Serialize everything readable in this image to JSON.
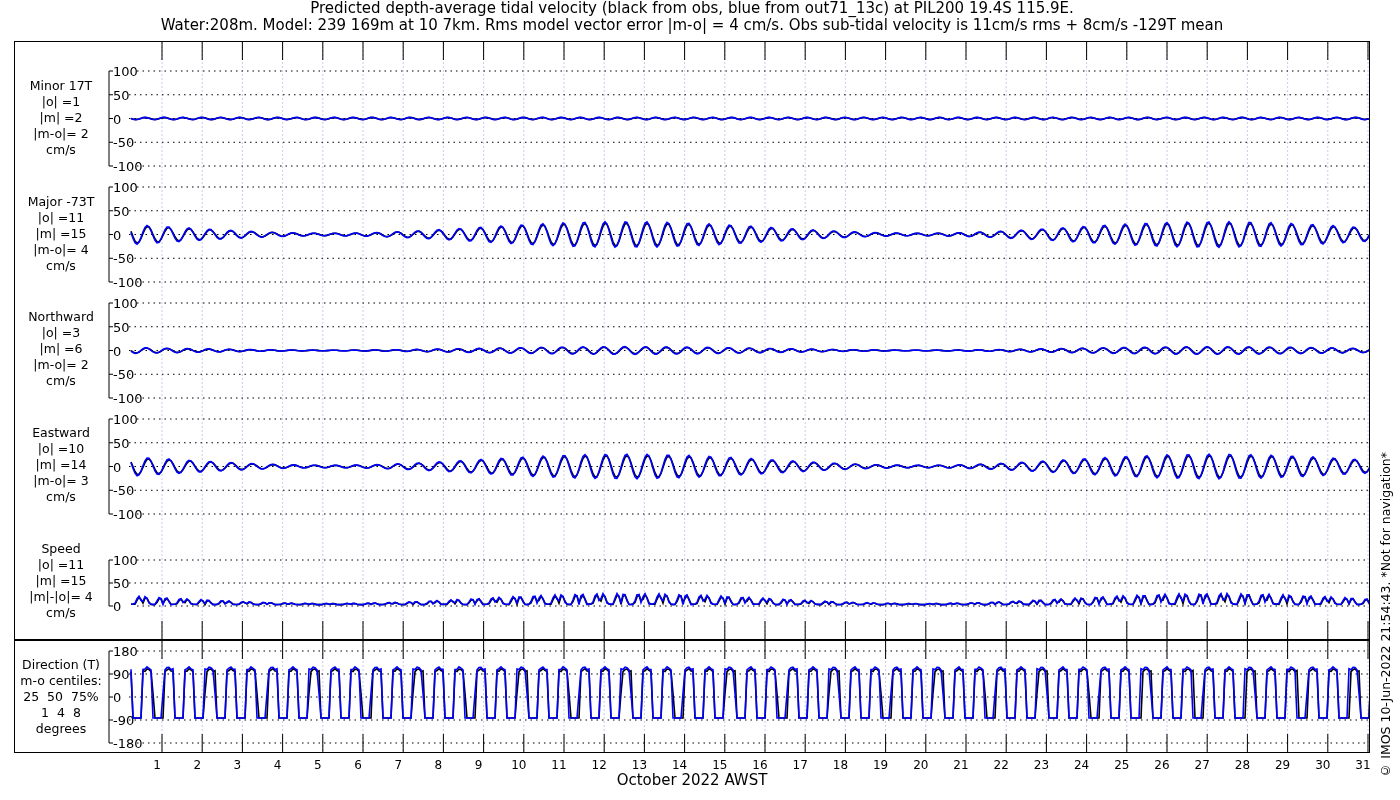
{
  "title_lines": [
    "Predicted depth-average tidal velocity (black from obs, blue from out71_13c) at PIL200 19.4S 115.9E.",
    "Water:208m. Model: 239 169m at 10 7km. Rms model vector error |m-o| = 4 cm/s. Obs sub-tidal velocity is 11cm/s rms + 8cm/s -129T mean"
  ],
  "panels": [
    {
      "kind": "minor",
      "label_lines": [
        "Minor 17T",
        "|o| =1",
        "|m| =2",
        "|m-o|= 2",
        "cm/s"
      ],
      "yticks": [
        "100",
        "50",
        "0",
        "-50",
        "-100"
      ]
    },
    {
      "kind": "major",
      "label_lines": [
        "Major -73T",
        "|o| =11",
        "|m| =15",
        "|m-o|= 4",
        "cm/s"
      ],
      "yticks": [
        "100",
        "50",
        "0",
        "-50",
        "-100"
      ]
    },
    {
      "kind": "north",
      "label_lines": [
        "Northward",
        "|o| =3",
        "|m| =6",
        "|m-o|= 2",
        "cm/s"
      ],
      "yticks": [
        "100",
        "50",
        "0",
        "-50",
        "-100"
      ]
    },
    {
      "kind": "east",
      "label_lines": [
        "Eastward",
        "|o| =10",
        "|m| =14",
        "|m-o|= 3",
        "cm/s"
      ],
      "yticks": [
        "100",
        "50",
        "0",
        "-50",
        "-100"
      ]
    },
    {
      "kind": "speed",
      "label_lines": [
        "Speed",
        "|o| =11",
        "|m| =15",
        "|m|-|o|= 4",
        "cm/s"
      ],
      "yticks": [
        "100",
        "50",
        "0"
      ]
    }
  ],
  "direction": {
    "kind": "direction",
    "label_lines": [
      "Direction (T)",
      "m-o centiles:",
      "25  50  75%",
      "1  4  8",
      "degrees"
    ],
    "yticks": [
      "180",
      "90",
      "0",
      "-90",
      "-180"
    ]
  },
  "xticks": [
    "1",
    "2",
    "3",
    "4",
    "5",
    "6",
    "7",
    "8",
    "9",
    "10",
    "11",
    "12",
    "13",
    "14",
    "15",
    "16",
    "17",
    "18",
    "19",
    "20",
    "21",
    "22",
    "23",
    "24",
    "25",
    "26",
    "27",
    "28",
    "29",
    "30",
    "31"
  ],
  "xlabel": "October 2022 AWST",
  "credit": "© IMOS 10-Jun-2022 21:54:43. *Not for navigation*"
}
